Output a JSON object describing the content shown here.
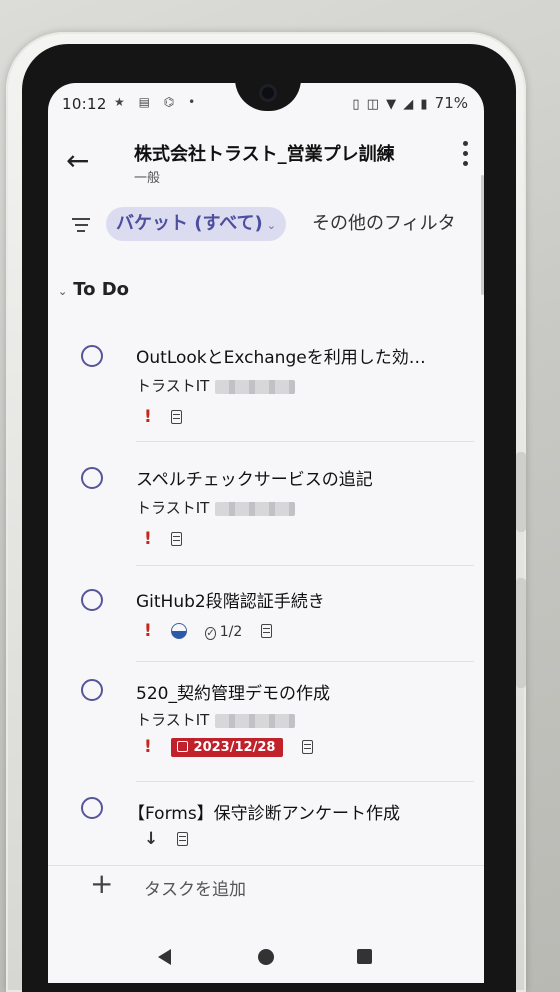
{
  "status_bar": {
    "time": "10:12",
    "battery": "71%"
  },
  "header": {
    "title": "株式会社トラスト_営業プレ訓練",
    "subtitle": "一般"
  },
  "filters": {
    "active": "バケット (すべて)",
    "other": "その他のフィルタ"
  },
  "section": {
    "label": "To Do"
  },
  "tasks": [
    {
      "title": "OutLookとExchangeを利用した効…",
      "bucket": "トラストIT",
      "priority": "!"
    },
    {
      "title": "スペルチェックサービスの追記",
      "bucket": "トラストIT",
      "priority": "!"
    },
    {
      "title": "GitHub2段階認証手続き",
      "priority": "!",
      "progress": "half",
      "checklist": "1/2"
    },
    {
      "title": "520_契約管理デモの作成",
      "bucket": "トラストIT",
      "priority": "!",
      "due": "2023/12/28"
    },
    {
      "title": "【Forms】保守診断アンケート作成",
      "priority": "↓"
    }
  ],
  "add_task": {
    "plus": "+",
    "label": "タスクを追加"
  },
  "colors": {
    "accent": "#4d4f9e",
    "chip_bg": "#dcdcf1",
    "priority_red": "#c4271d",
    "due_red": "#c1212a"
  }
}
